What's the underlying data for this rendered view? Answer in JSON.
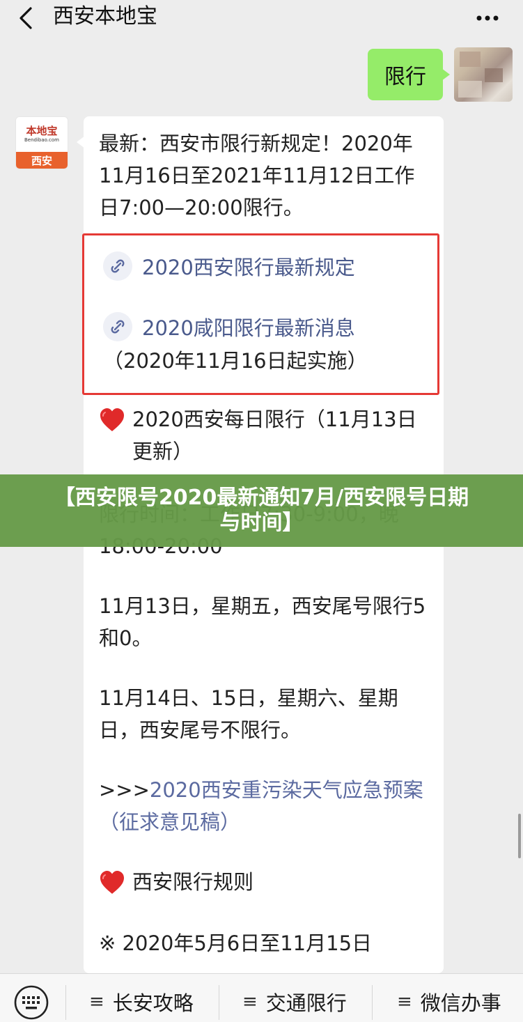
{
  "header": {
    "title": "西安本地宝"
  },
  "chat": {
    "user_message": "限行",
    "bot_avatar": {
      "logo_name": "本地宝",
      "logo_url": "Bendibao.com",
      "city": "西安"
    },
    "intro": "最新：西安市限行新规定！2020年11月16日至2021年11月12日工作日7:00—20:00限行。",
    "links": [
      {
        "label": "2020西安限行最新规定"
      },
      {
        "label": "2020咸阳限行最新消息"
      }
    ],
    "links_note": "（2020年11月16日起实施）",
    "daily_title": "2020西安每日限行（11月13日更新）",
    "time_line": "限行时间：工作日7:30-9:00，晚18:00-20:00",
    "day1": "11月13日，星期五，西安尾号限行5和0。",
    "day2": "11月14日、15日，星期六、星期日，西安尾号不限行。",
    "plan_prefix": ">>>",
    "plan_link": "2020西安重污染天气应急预案（征求意见稿）",
    "rules_title": "西安限行规则",
    "rules_line": "※ 2020年5月6日至11月15日"
  },
  "banner": {
    "line1": "【西安限号2020最新通知7月/西安限号日期",
    "line2": "与时间】"
  },
  "bottom_nav": {
    "items": [
      {
        "label": "长安攻略"
      },
      {
        "label": "交通限行"
      },
      {
        "label": "微信办事"
      }
    ],
    "menu_glyph": "≡"
  },
  "colors": {
    "user_bubble": "#95ec69",
    "red_box": "#e53935",
    "banner": "#669a48",
    "link": "#5b6aa0"
  }
}
